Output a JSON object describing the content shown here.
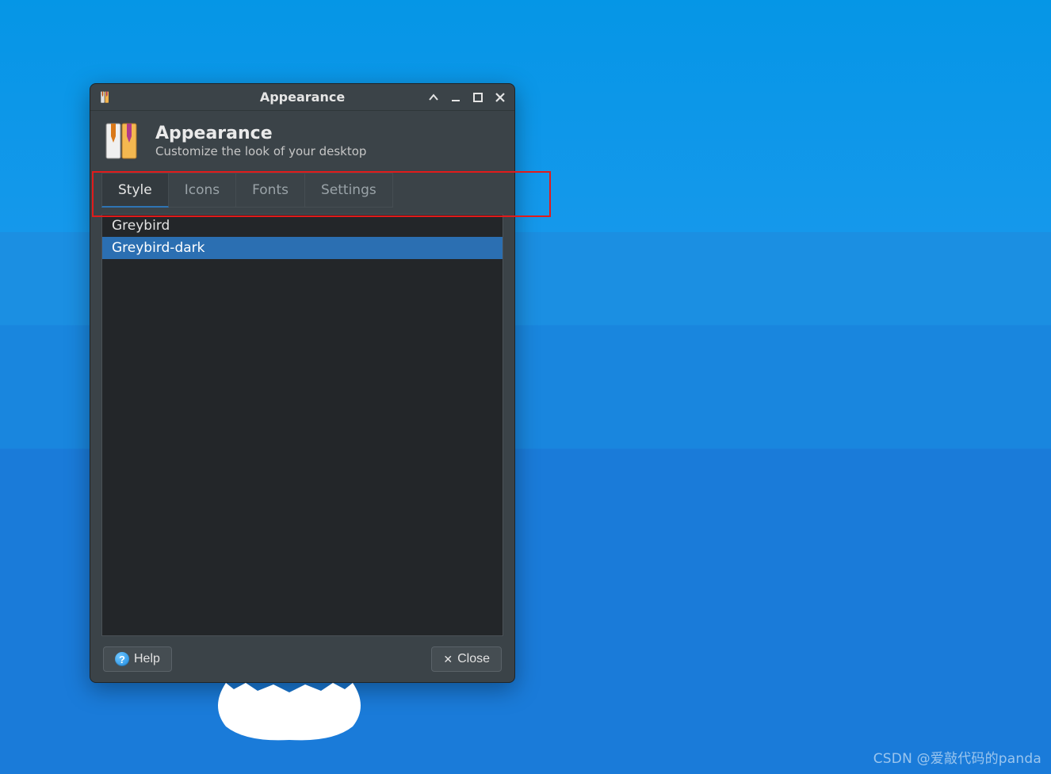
{
  "window": {
    "title": "Appearance"
  },
  "header": {
    "title": "Appearance",
    "subtitle": "Customize the look of your desktop"
  },
  "tabs": [
    {
      "label": "Style",
      "active": true
    },
    {
      "label": "Icons",
      "active": false
    },
    {
      "label": "Fonts",
      "active": false
    },
    {
      "label": "Settings",
      "active": false
    }
  ],
  "styles_list": [
    {
      "name": "Greybird",
      "selected": false
    },
    {
      "name": "Greybird-dark",
      "selected": true
    }
  ],
  "footer": {
    "help_label": "Help",
    "close_label": "Close"
  },
  "watermark": "CSDN @爱敲代码的panda"
}
